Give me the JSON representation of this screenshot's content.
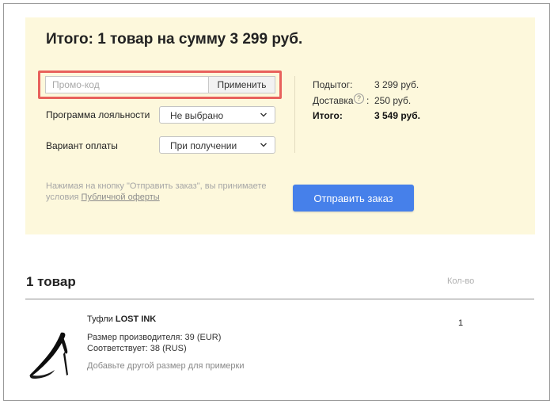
{
  "summary": {
    "title": "Итого: 1 товар на сумму 3 299 руб."
  },
  "promo": {
    "placeholder": "Промо-код",
    "value": "",
    "apply_label": "Применить"
  },
  "loyalty": {
    "label": "Программа лояльности",
    "selected": "Не выбрано"
  },
  "payment": {
    "label": "Вариант оплаты",
    "selected": "При получении"
  },
  "totals": {
    "subtotal_label": "Подытог:",
    "subtotal_value": "3 299 руб.",
    "delivery_label": "Доставка",
    "delivery_help": "?",
    "delivery_colon": ":",
    "delivery_value": "250 руб.",
    "total_label": "Итого:",
    "total_value": "3 549 руб."
  },
  "terms": {
    "line1": "Нажимая на кнопку \"Отправить заказ\", вы принимаете",
    "line2_prefix": "условия ",
    "link": "Публичной оферты"
  },
  "submit_label": "Отправить заказ",
  "cart": {
    "heading": "1 товар",
    "qty_header": "Кол-во",
    "items": [
      {
        "name_prefix": "Туфли ",
        "brand": "LOST INK",
        "size": "Размер производителя: 39 (EUR)",
        "match": "Соответствует: 38 (RUS)",
        "add_size": "Добавьте другой размер для примерки",
        "quantity": "1"
      }
    ]
  },
  "icons": {
    "select_arrow": "chevron-down-icon",
    "help": "question-circle-icon",
    "product": "black-stiletto-shoe"
  },
  "colors": {
    "panel_background": "#fdf8dc",
    "highlight": "#e8615c",
    "primary_button": "#4680ea"
  }
}
